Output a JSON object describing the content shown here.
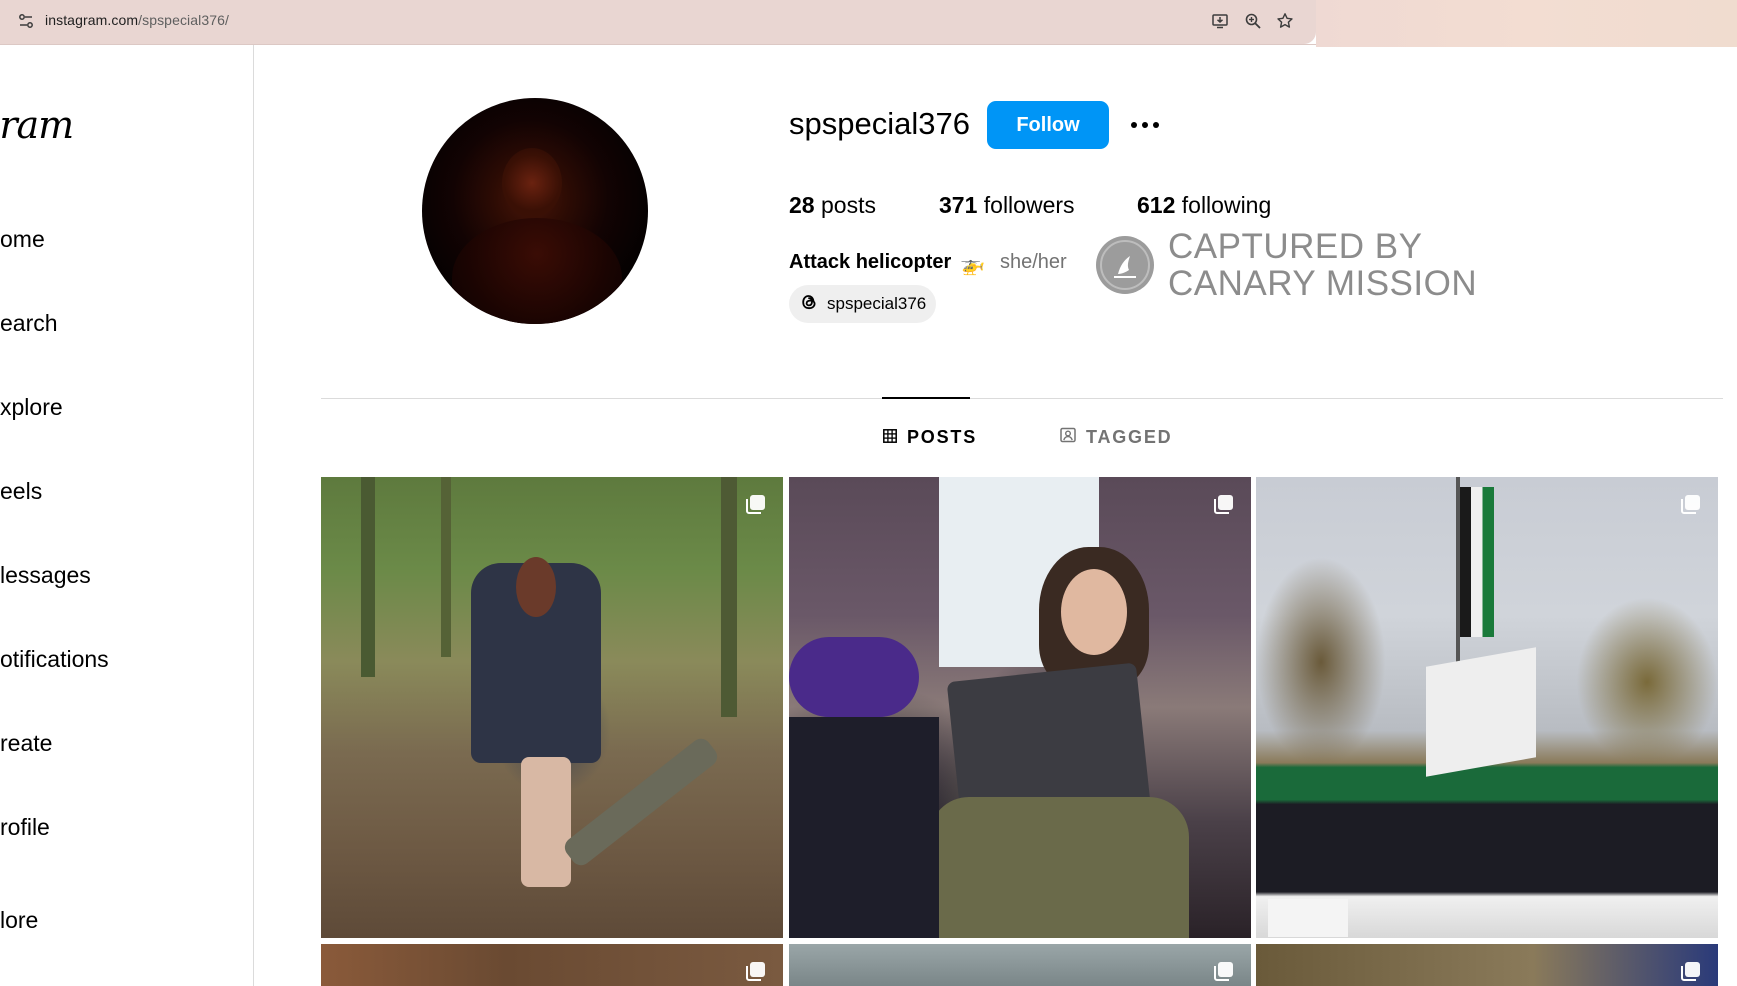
{
  "browser": {
    "url_host": "instagram.com",
    "url_path": "/spspecial376/",
    "icons": [
      "site-settings-icon",
      "install-app-icon",
      "zoom-icon",
      "bookmark-star-icon"
    ]
  },
  "sidebar": {
    "logo": "gram",
    "items": [
      {
        "label": "ome",
        "icon": "home-icon"
      },
      {
        "label": "earch",
        "icon": "search-icon"
      },
      {
        "label": "xplore",
        "icon": "explore-icon"
      },
      {
        "label": "eels",
        "icon": "reels-icon"
      },
      {
        "label": "lessages",
        "icon": "messages-icon"
      },
      {
        "label": "otifications",
        "icon": "notifications-icon"
      },
      {
        "label": "reate",
        "icon": "create-icon"
      },
      {
        "label": "rofile",
        "icon": "profile-icon"
      },
      {
        "label": "lore",
        "icon": "more-icon"
      }
    ]
  },
  "profile": {
    "username": "spspecial376",
    "follow_label": "Follow",
    "posts_count": "28",
    "posts_label": " posts",
    "followers_count": "371",
    "followers_label": " followers",
    "following_count": "612",
    "following_label": " following",
    "bio_name": "Attack helicopter",
    "bio_emoji": "🚁",
    "pronouns": "she/her",
    "threads_handle": "spspecial376"
  },
  "watermark": {
    "line1": "CAPTURED BY",
    "line2": "CANARY MISSION"
  },
  "tabs": [
    {
      "label": "POSTS",
      "active": true,
      "icon": "grid-icon"
    },
    {
      "label": "TAGGED",
      "active": false,
      "icon": "tagged-icon"
    }
  ],
  "posts": [
    {
      "multi": true
    },
    {
      "multi": true
    },
    {
      "multi": true
    },
    {
      "multi": true
    },
    {
      "multi": true
    },
    {
      "multi": true
    }
  ],
  "colors": {
    "follow_button": "#0095f6",
    "urlbar": "#e9d6d2",
    "secondary_text": "#737373",
    "watermark": "#8c8c8c"
  }
}
